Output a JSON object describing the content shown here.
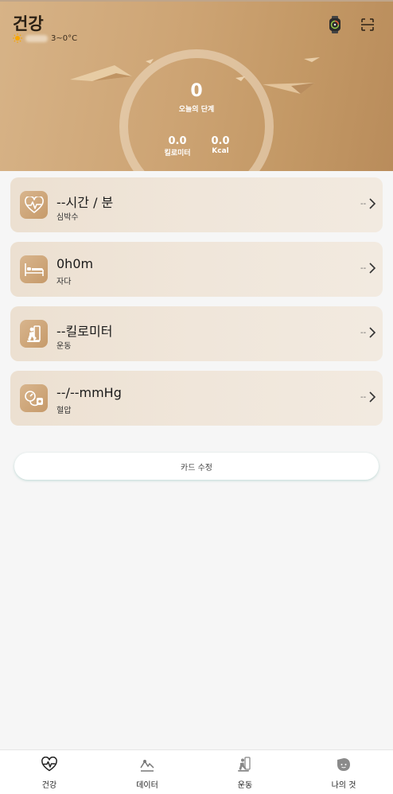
{
  "header": {
    "title": "건강",
    "weather_icon": "sun-icon",
    "temperature": "3~0°C",
    "right_icons": [
      "watch-icon",
      "scan-icon"
    ]
  },
  "activity": {
    "steps_value": "0",
    "steps_label": "오늘의 단계",
    "distance_value": "0.0",
    "distance_label": "킬로미터",
    "calories_value": "0.0",
    "calories_label": "Kcal"
  },
  "cards": [
    {
      "icon": "heart-rate-icon",
      "value": "--시간 / 분",
      "label": "심박수",
      "trailing": "--"
    },
    {
      "icon": "bed-icon",
      "value": "0h0m",
      "label": "자다",
      "trailing": "--"
    },
    {
      "icon": "exercise-icon",
      "value": "--킬로미터",
      "label": "운동",
      "trailing": "--"
    },
    {
      "icon": "blood-pressure-icon",
      "value": "--/--mmHg",
      "label": "혈압",
      "trailing": "--"
    }
  ],
  "edit_card_button": "카드 수정",
  "bottom_nav": [
    {
      "label": "건강",
      "icon": "heart-rate-icon"
    },
    {
      "label": "데이터",
      "icon": "chart-icon"
    },
    {
      "label": "운동",
      "icon": "exercise-icon"
    },
    {
      "label": "나의 것",
      "icon": "profile-icon"
    }
  ],
  "colors": {
    "hero_gradient_start": "#d7b387",
    "hero_gradient_end": "#b98c5b",
    "card_background": "#efe4d8",
    "card_icon_bg": "#cfa577",
    "page_background": "#f6f6f6"
  }
}
